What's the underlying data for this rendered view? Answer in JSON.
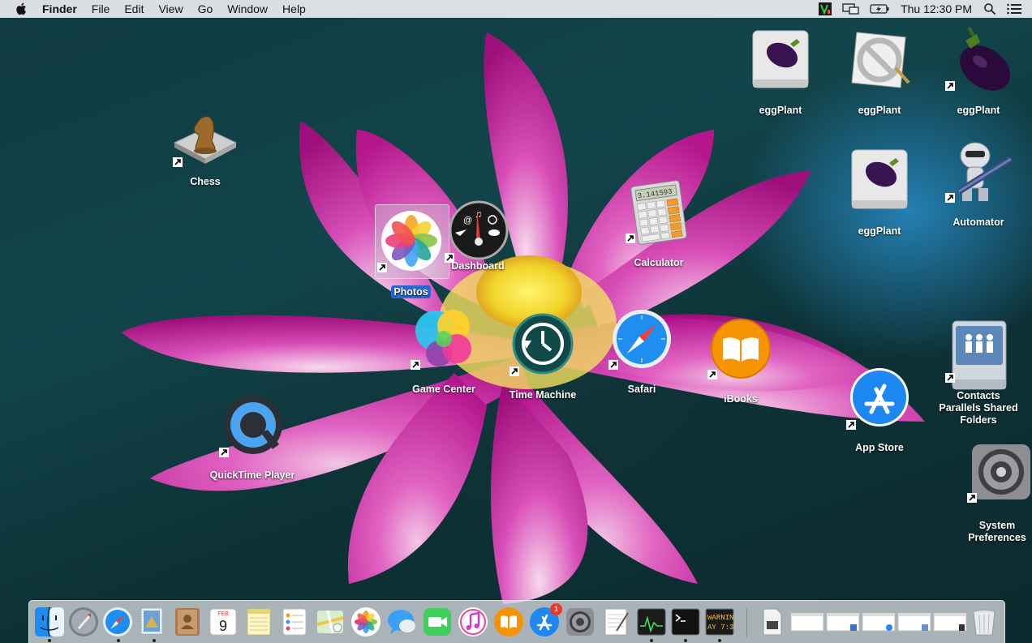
{
  "menubar": {
    "app_name": "Finder",
    "menus": [
      "File",
      "Edit",
      "View",
      "Go",
      "Window",
      "Help"
    ],
    "clock": "Thu 12:30 PM"
  },
  "desktop_icons": {
    "chess": "Chess",
    "photos": "Photos",
    "dashboard": "Dashboard",
    "calculator": "Calculator",
    "calculator_display": "3.141593",
    "game_center": "Game Center",
    "time_machine": "Time Machine",
    "safari": "Safari",
    "ibooks": "iBooks",
    "quicktime": "QuickTime Player",
    "eggplant_drive_1": "eggPlant",
    "eggplant_app_disabled": "eggPlant",
    "eggplant_alias": "eggPlant",
    "eggplant_drive_2": "eggPlant",
    "automator": "Automator",
    "contacts_shared": "Contacts Parallels Shared Folders",
    "app_store": "App Store",
    "system_preferences": "System Preferences"
  },
  "dock": {
    "calendar_month": "FEB",
    "calendar_day": "9",
    "app_store_badge": "1",
    "console_text_1": "WARNIN",
    "console_text_2": "AY 7:36"
  },
  "colors": {
    "selection": "#2a68d0",
    "badge": "#e8392c",
    "lotus_petal": "#c8259e"
  }
}
